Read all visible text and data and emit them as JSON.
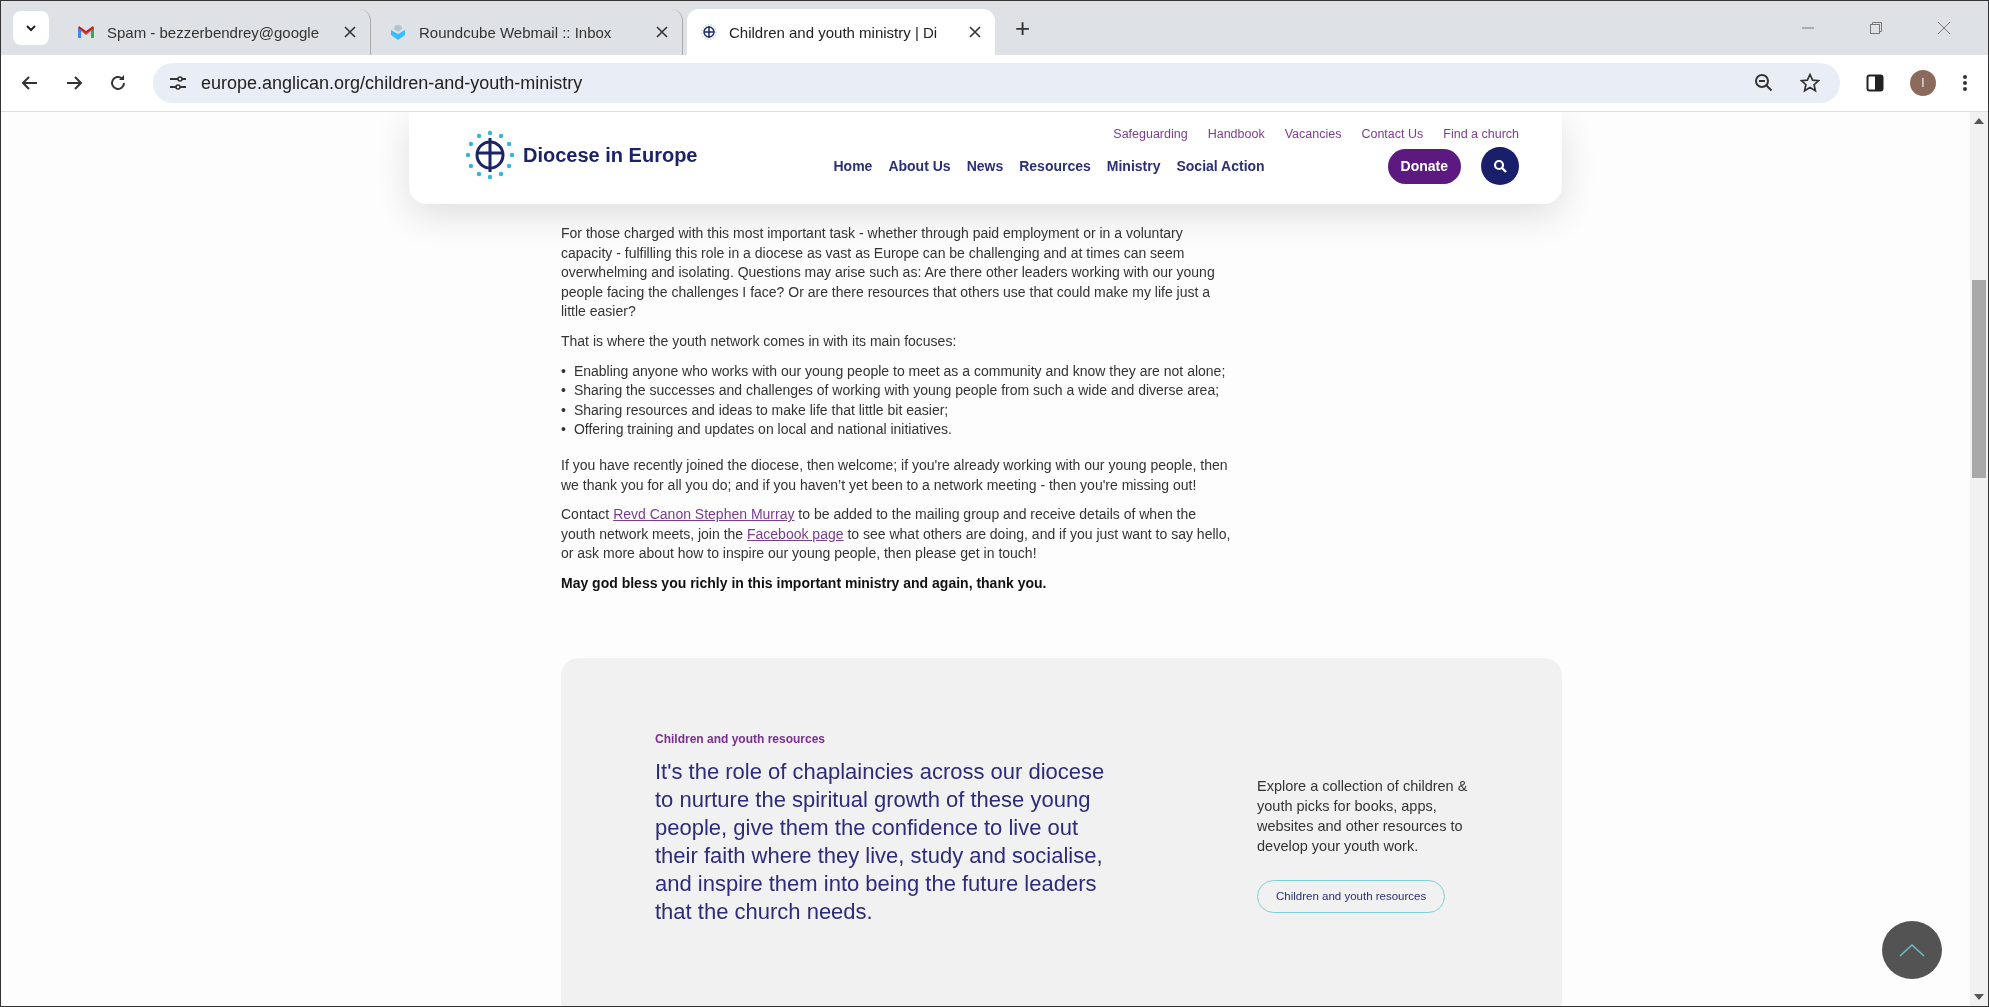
{
  "browser": {
    "tabs": [
      {
        "title": "Spam - bezzerbendrey@google",
        "kind": "gmail",
        "selected": false
      },
      {
        "title": "Roundcube Webmail :: Inbox",
        "kind": "roundcube",
        "selected": false
      },
      {
        "title": "Children and youth ministry | Di",
        "kind": "diocese",
        "selected": true
      }
    ],
    "new_tab": "+",
    "url": "europe.anglican.org/children-and-youth-ministry",
    "avatar": "I"
  },
  "header": {
    "logo": "Diocese in Europe",
    "utility_links": [
      "Safeguarding",
      "Handbook",
      "Vacancies",
      "Contact Us",
      "Find a church"
    ],
    "nav": [
      "Home",
      "About Us",
      "News",
      "Resources",
      "Ministry",
      "Social Action"
    ],
    "donate": "Donate"
  },
  "content": [
    {
      "kind": "paragraph",
      "text": "For those charged with this most important task - whether through paid employment or in a voluntary capacity - fulfilling this role in a diocese as vast as Europe can be challenging and at times can seem overwhelming and isolating. Questions may arise such as: Are there other leaders working with our young people facing the challenges I face? Or are there resources that others use that could make my life just a little easier?"
    },
    {
      "kind": "paragraph",
      "text": "That is where the youth network comes in with its main focuses:"
    },
    {
      "kind": "list",
      "marker": "•",
      "items": [
        "Enabling anyone who works with our young people to meet as a community and know they are not alone;",
        "Sharing the successes and challenges of working with young people from such a wide and diverse area;",
        "Sharing resources and ideas to make life that little bit easier;",
        "Offering training and updates on local and national initiatives."
      ]
    },
    {
      "kind": "paragraph",
      "text": "If you have recently joined the diocese, then welcome; if you're already working with our young people, then we thank you for all you do; and if you haven’t yet been to a network meeting - then you're missing out!"
    },
    {
      "kind": "links",
      "parts": [
        {
          "text": "Contact ",
          "kind": "text"
        },
        {
          "text": "Revd Canon Stephen Murray",
          "kind": "link"
        },
        {
          "text": " to be added to the mailing group and receive details of when the youth network meets, join the ",
          "kind": "text"
        },
        {
          "text": "Facebook page",
          "kind": "link"
        },
        {
          "text": " to see what others are doing, and if you just want to say hello, or ask more about how to inspire our young people, then please get in touch!",
          "kind": "text"
        }
      ]
    },
    {
      "kind": "bold",
      "text": "May god bless you richly in this important ministry and again, thank you."
    }
  ],
  "resources": {
    "eyebrow": "Children and youth resources",
    "quote": "It's the role of chaplaincies across our diocese to nurture the spiritual growth of these young people, give them the confidence to live out their faith where they live, study and socialise, and inspire them into being the future leaders that the church needs.",
    "description": "Explore a collection of children & youth picks for books, apps, websites and other resources to develop your youth work.",
    "button": "Children and youth resources"
  }
}
